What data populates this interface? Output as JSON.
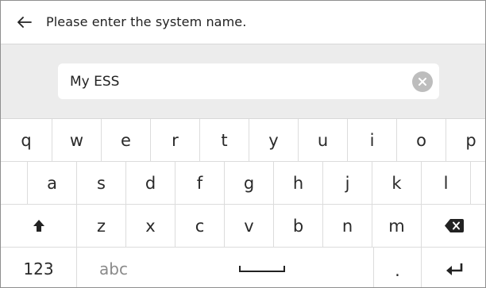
{
  "header": {
    "back_icon": "arrow-left-icon",
    "title": "Please enter the system name."
  },
  "input": {
    "value": "My ESS",
    "clear_icon": "clear-circle-icon"
  },
  "keyboard": {
    "row1": [
      "q",
      "w",
      "e",
      "r",
      "t",
      "y",
      "u",
      "i",
      "o",
      "p"
    ],
    "row2": [
      "a",
      "s",
      "d",
      "f",
      "g",
      "h",
      "j",
      "k",
      "l"
    ],
    "row3": [
      "z",
      "x",
      "c",
      "v",
      "b",
      "n",
      "m"
    ],
    "shift_icon": "shift-arrow-icon",
    "backspace_icon": "backspace-icon",
    "numbers_label": "123",
    "abc_label": "abc",
    "space_icon": "space-bar-icon",
    "period_label": ".",
    "enter_icon": "enter-return-icon"
  },
  "colors": {
    "band": "#ececec",
    "clear_button": "#bdbdbd",
    "divider": "#dcdcdc"
  }
}
